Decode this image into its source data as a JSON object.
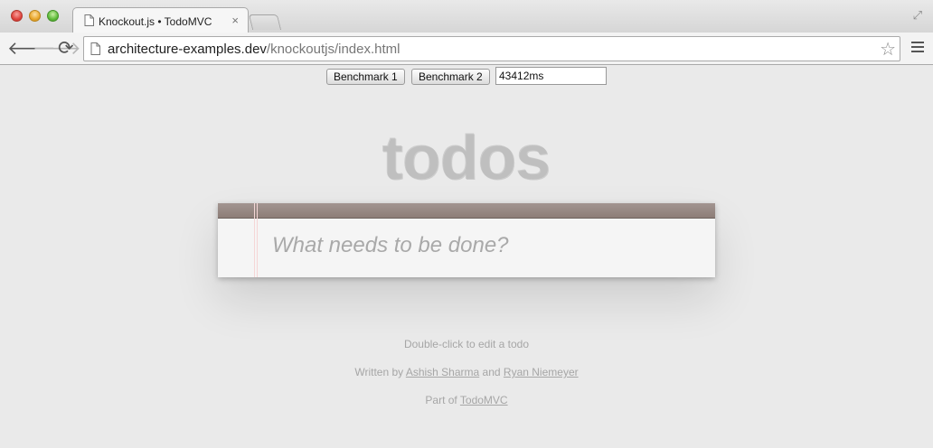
{
  "browser": {
    "tab": {
      "title": "Knockout.js • TodoMVC",
      "close_glyph": "×"
    },
    "address": {
      "host": "architecture-examples.dev",
      "path": "/knockoutjs/index.html"
    }
  },
  "benchmark": {
    "button1_label": "Benchmark 1",
    "button2_label": "Benchmark 2",
    "result_value": "43412ms"
  },
  "app": {
    "title": "todos",
    "new_todo_placeholder": "What needs to be done?"
  },
  "footer": {
    "hint": "Double-click to edit a todo",
    "written_by_prefix": "Written by",
    "author1": "Ashish Sharma",
    "and_word": "and",
    "author2": "Ryan Niemeyer",
    "part_of_prefix": "Part of",
    "todomvc_link": "TodoMVC"
  },
  "icons": [
    "page-icon",
    "close-icon",
    "back-arrow-icon",
    "forward-arrow-icon",
    "reload-icon",
    "star-icon",
    "menu-icon",
    "fullscreen-icon"
  ]
}
